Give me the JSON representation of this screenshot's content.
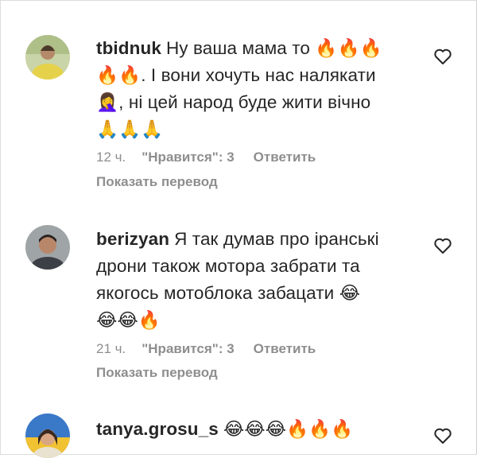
{
  "comments": [
    {
      "username": "tbidnuk",
      "lines": [
        "Ну ваша мама то 🔥🔥🔥",
        "🔥🔥. І вони хочуть нас налякати",
        "🤦‍♀️, ні цей народ буде жити вічно",
        "🙏🙏🙏"
      ],
      "time": "12 ч.",
      "likes": "\"Нравится\": 3",
      "reply": "Ответить",
      "translate": "Показать перевод"
    },
    {
      "username": "berizyan",
      "lines": [
        "Я так думав про іранські",
        "дрони також мотора забрати та",
        "якогось мотоблока забацати 😂",
        "😂😂🔥"
      ],
      "time": "21 ч.",
      "likes": "\"Нравится\": 3",
      "reply": "Ответить",
      "translate": "Показать перевод"
    },
    {
      "username": "tanya.grosu_s",
      "lines": [
        "😂😂😂🔥🔥🔥"
      ]
    }
  ],
  "icons": {
    "like": "heart-outline-icon"
  },
  "colors": {
    "text": "#262626",
    "secondary": "#8e8e8e"
  }
}
